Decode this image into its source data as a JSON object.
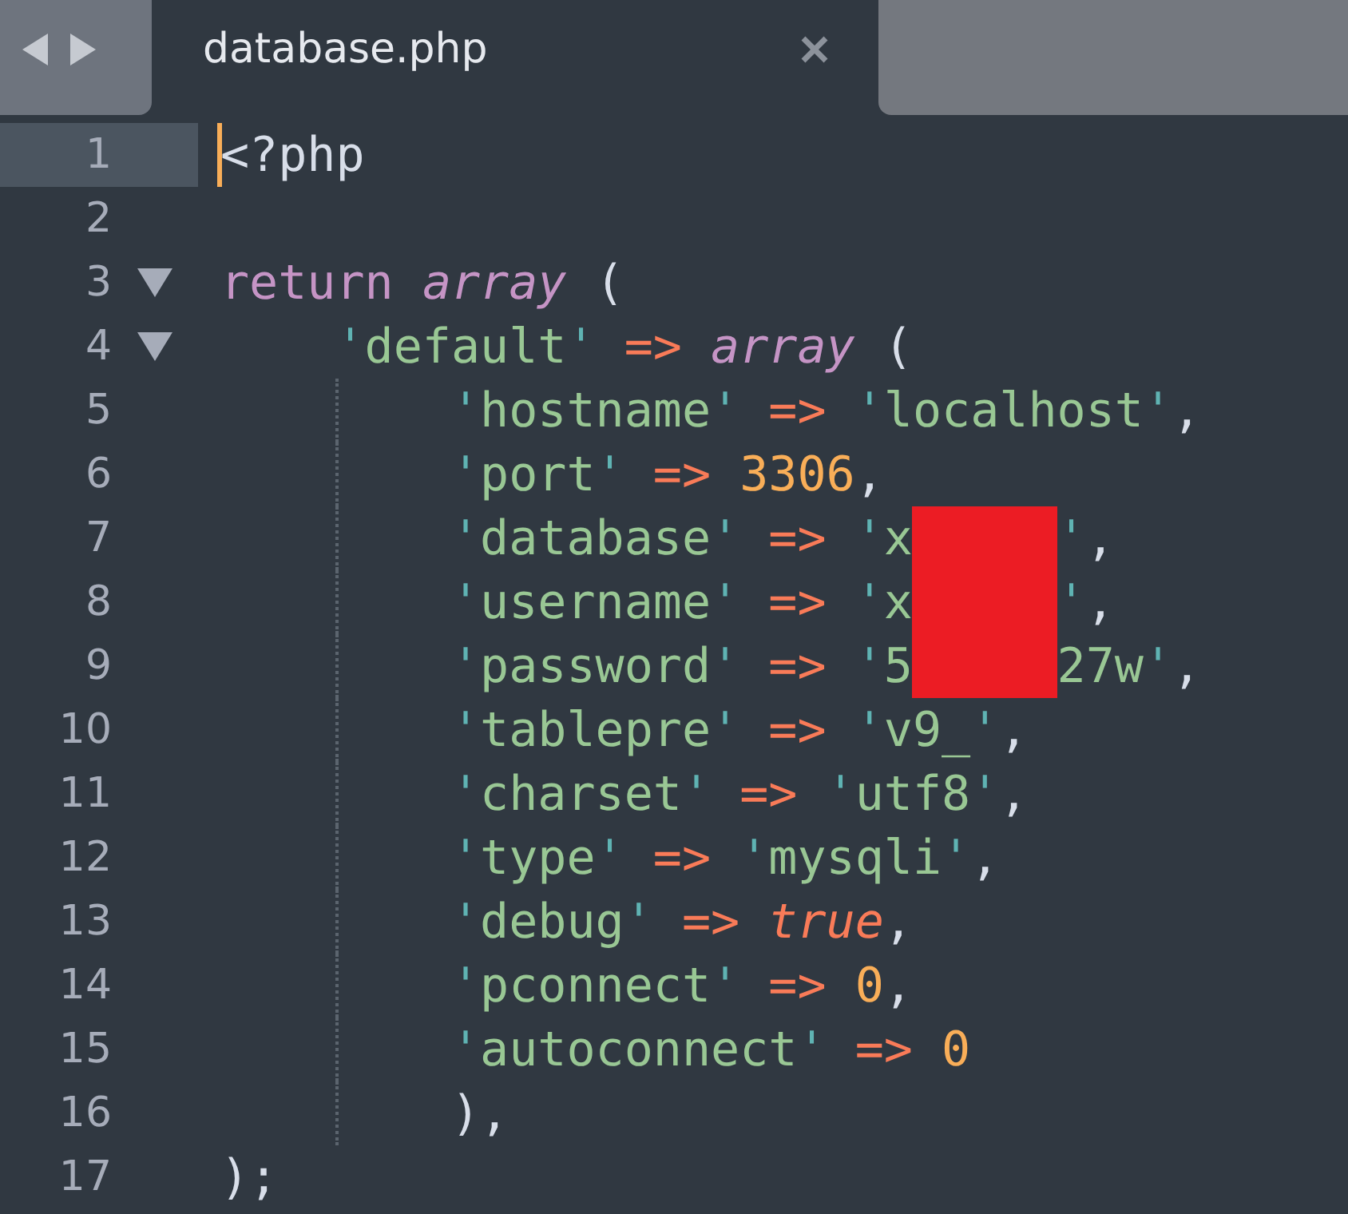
{
  "tabs": [
    {
      "label": "database.php",
      "selected": true
    }
  ],
  "lines": [
    {
      "number": "1",
      "current": true,
      "fold": false,
      "tokens": [
        {
          "kind": "punct",
          "text": "<?php"
        }
      ]
    },
    {
      "number": "2",
      "current": false,
      "fold": false
    },
    {
      "number": "3",
      "current": false,
      "fold": true,
      "tokens": [
        {
          "kind": "keyword",
          "text": "return "
        },
        {
          "kind": "storage",
          "text": "array"
        },
        {
          "kind": "punct",
          "text": " ("
        }
      ],
      "children": [
        {
          "number": "4",
          "current": false,
          "fold": true,
          "tokens": [
            {
              "kind": "quote",
              "text": "'"
            },
            {
              "kind": "string",
              "text": "default"
            },
            {
              "kind": "quote",
              "text": "'"
            },
            {
              "kind": "operator",
              "text": " => "
            },
            {
              "kind": "storage",
              "text": "array"
            },
            {
              "kind": "punct",
              "text": " ("
            }
          ],
          "children": [
            {
              "number": "5",
              "current": false,
              "fold": false,
              "tokens": [
                {
                  "kind": "quote",
                  "text": "'"
                },
                {
                  "kind": "string",
                  "text": "hostname"
                },
                {
                  "kind": "quote",
                  "text": "'"
                },
                {
                  "kind": "operator",
                  "text": " => "
                },
                {
                  "kind": "quote",
                  "text": "'"
                },
                {
                  "kind": "string",
                  "text": "localhost"
                },
                {
                  "kind": "quote",
                  "text": "'"
                },
                {
                  "kind": "punct",
                  "text": ","
                }
              ]
            },
            {
              "number": "6",
              "current": false,
              "fold": false,
              "tokens": [
                {
                  "kind": "quote",
                  "text": "'"
                },
                {
                  "kind": "string",
                  "text": "port"
                },
                {
                  "kind": "quote",
                  "text": "'"
                },
                {
                  "kind": "operator",
                  "text": " => "
                },
                {
                  "kind": "number",
                  "text": "3306"
                },
                {
                  "kind": "punct",
                  "text": ","
                }
              ]
            },
            {
              "number": "7",
              "current": false,
              "fold": false,
              "tokens": [
                {
                  "kind": "quote",
                  "text": "'"
                },
                {
                  "kind": "string",
                  "text": "database"
                },
                {
                  "kind": "quote",
                  "text": "'"
                },
                {
                  "kind": "operator",
                  "text": " => "
                },
                {
                  "kind": "quote",
                  "text": "'"
                },
                {
                  "kind": "string",
                  "text": "x"
                },
                {
                  "kind": "redaction"
                },
                {
                  "kind": "quote",
                  "text": "'"
                },
                {
                  "kind": "punct",
                  "text": ","
                }
              ]
            },
            {
              "number": "8",
              "current": false,
              "fold": false,
              "tokens": [
                {
                  "kind": "quote",
                  "text": "'"
                },
                {
                  "kind": "string",
                  "text": "username"
                },
                {
                  "kind": "quote",
                  "text": "'"
                },
                {
                  "kind": "operator",
                  "text": " => "
                },
                {
                  "kind": "quote",
                  "text": "'"
                },
                {
                  "kind": "string",
                  "text": "x"
                },
                {
                  "kind": "redaction"
                },
                {
                  "kind": "quote",
                  "text": "'"
                },
                {
                  "kind": "punct",
                  "text": ","
                }
              ]
            },
            {
              "number": "9",
              "current": false,
              "fold": false,
              "tokens": [
                {
                  "kind": "quote",
                  "text": "'"
                },
                {
                  "kind": "string",
                  "text": "password"
                },
                {
                  "kind": "quote",
                  "text": "'"
                },
                {
                  "kind": "operator",
                  "text": " => "
                },
                {
                  "kind": "quote",
                  "text": "'"
                },
                {
                  "kind": "string",
                  "text": "5"
                },
                {
                  "kind": "redaction"
                },
                {
                  "kind": "string",
                  "text": "27w"
                },
                {
                  "kind": "quote",
                  "text": "'"
                },
                {
                  "kind": "punct",
                  "text": ","
                }
              ]
            },
            {
              "number": "10",
              "current": false,
              "fold": false,
              "tokens": [
                {
                  "kind": "quote",
                  "text": "'"
                },
                {
                  "kind": "string",
                  "text": "tablepre"
                },
                {
                  "kind": "quote",
                  "text": "'"
                },
                {
                  "kind": "operator",
                  "text": " => "
                },
                {
                  "kind": "quote",
                  "text": "'"
                },
                {
                  "kind": "string",
                  "text": "v9_"
                },
                {
                  "kind": "quote",
                  "text": "'"
                },
                {
                  "kind": "punct",
                  "text": ","
                }
              ]
            },
            {
              "number": "11",
              "current": false,
              "fold": false,
              "tokens": [
                {
                  "kind": "quote",
                  "text": "'"
                },
                {
                  "kind": "string",
                  "text": "charset"
                },
                {
                  "kind": "quote",
                  "text": "'"
                },
                {
                  "kind": "operator",
                  "text": " => "
                },
                {
                  "kind": "quote",
                  "text": "'"
                },
                {
                  "kind": "string",
                  "text": "utf8"
                },
                {
                  "kind": "quote",
                  "text": "'"
                },
                {
                  "kind": "punct",
                  "text": ","
                }
              ]
            },
            {
              "number": "12",
              "current": false,
              "fold": false,
              "tokens": [
                {
                  "kind": "quote",
                  "text": "'"
                },
                {
                  "kind": "string",
                  "text": "type"
                },
                {
                  "kind": "quote",
                  "text": "'"
                },
                {
                  "kind": "operator",
                  "text": " => "
                },
                {
                  "kind": "quote",
                  "text": "'"
                },
                {
                  "kind": "string",
                  "text": "mysqli"
                },
                {
                  "kind": "quote",
                  "text": "'"
                },
                {
                  "kind": "punct",
                  "text": ","
                }
              ]
            },
            {
              "number": "13",
              "current": false,
              "fold": false,
              "tokens": [
                {
                  "kind": "quote",
                  "text": "'"
                },
                {
                  "kind": "string",
                  "text": "debug"
                },
                {
                  "kind": "quote",
                  "text": "'"
                },
                {
                  "kind": "operator",
                  "text": " => "
                },
                {
                  "kind": "constant",
                  "text": "true"
                },
                {
                  "kind": "punct",
                  "text": ","
                }
              ]
            },
            {
              "number": "14",
              "current": false,
              "fold": false,
              "tokens": [
                {
                  "kind": "quote",
                  "text": "'"
                },
                {
                  "kind": "string",
                  "text": "pconnect"
                },
                {
                  "kind": "quote",
                  "text": "'"
                },
                {
                  "kind": "operator",
                  "text": " => "
                },
                {
                  "kind": "number",
                  "text": "0"
                },
                {
                  "kind": "punct",
                  "text": ","
                }
              ]
            },
            {
              "number": "15",
              "current": false,
              "fold": false,
              "tokens": [
                {
                  "kind": "quote",
                  "text": "'"
                },
                {
                  "kind": "string",
                  "text": "autoconnect"
                },
                {
                  "kind": "quote",
                  "text": "'"
                },
                {
                  "kind": "operator",
                  "text": " => "
                },
                {
                  "kind": "number",
                  "text": "0"
                }
              ]
            },
            {
              "number": "16",
              "current": false,
              "fold": false,
              "tokens": [
                {
                  "kind": "punct",
                  "text": "),"
                }
              ]
            }
          ]
        }
      ]
    },
    {
      "number": "17",
      "current": false,
      "fold": false,
      "tokens": [
        {
          "kind": "punct",
          "text": ");"
        }
      ]
    }
  ]
}
